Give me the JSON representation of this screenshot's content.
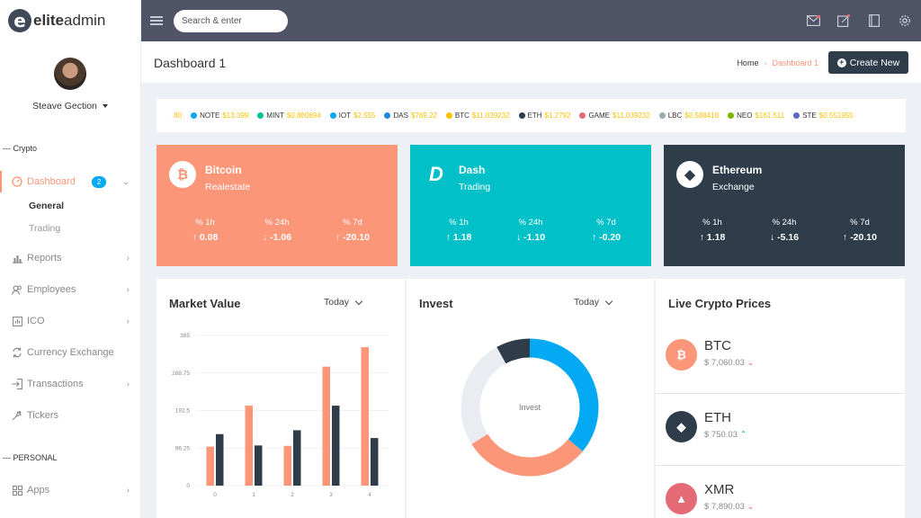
{
  "app": {
    "logo_mark": "e",
    "logo_bold": "elite",
    "logo_light": "admin"
  },
  "user": {
    "name": "Steave Gection"
  },
  "nav": {
    "caption_crypto": "--- Crypto",
    "caption_personal": "--- PERSONAL",
    "dashboard": {
      "label": "Dashboard",
      "badge": "2",
      "icon": "gauge-icon"
    },
    "sub": {
      "general": "General",
      "trading": "Trading"
    },
    "items": [
      {
        "label": "Reports",
        "icon": "bar-chart-icon",
        "has_children": true
      },
      {
        "label": "Employees",
        "icon": "users-icon",
        "has_children": true
      },
      {
        "label": "ICO",
        "icon": "ico-icon",
        "has_children": true
      },
      {
        "label": "Currency Exchange",
        "icon": "exchange-icon",
        "has_children": false
      },
      {
        "label": "Transactions",
        "icon": "sign-in-icon",
        "has_children": true
      },
      {
        "label": "Tickers",
        "icon": "tickers-icon",
        "has_children": false
      }
    ],
    "apps": {
      "label": "Apps",
      "icon": "grid-icon"
    }
  },
  "topbar": {
    "search_placeholder": "Search & enter",
    "icons": [
      "mail-icon",
      "edit-icon",
      "book-icon",
      "gear-icon"
    ]
  },
  "page": {
    "title": "Dashboard 1",
    "breadcrumb_home": "Home",
    "breadcrumb_current": "Dashboard 1",
    "create_button": "Create New"
  },
  "ticker": [
    {
      "sym": "",
      "val": ".80",
      "color": "#fec107"
    },
    {
      "sym": "NOTE",
      "val": "$13.399",
      "color": "#03a9f3"
    },
    {
      "sym": "MINT",
      "val": "$0.880694",
      "color": "#00c292"
    },
    {
      "sym": "IOT",
      "val": "$2.555",
      "color": "#03a9f3"
    },
    {
      "sym": "DAS",
      "val": "$769.22",
      "color": "#1e88e5"
    },
    {
      "sym": "BTC",
      "val": "$11.039232",
      "color": "#fec107"
    },
    {
      "sym": "ETH",
      "val": "$1.2792",
      "color": "#2f3d4a"
    },
    {
      "sym": "GAME",
      "val": "$11.039232",
      "color": "#e46a76"
    },
    {
      "sym": "LBC",
      "val": "$0.588418",
      "color": "#99abb4"
    },
    {
      "sym": "NEO",
      "val": "$161.511",
      "color": "#7ab800"
    },
    {
      "sym": "STE",
      "val": "$0.551955",
      "color": "#5c6bc0"
    }
  ],
  "coins": [
    {
      "name": "Bitcoin",
      "sub": "Realestate",
      "logo": "₿",
      "logo_icon": "bitcoin-icon",
      "bg": "#fb9678",
      "stats": [
        {
          "k": "% 1h",
          "v": "0.08",
          "dir": "↑"
        },
        {
          "k": "% 24h",
          "v": "-1.06",
          "dir": "↓"
        },
        {
          "k": "% 7d",
          "v": "-20.10",
          "dir": "↑"
        }
      ]
    },
    {
      "name": "Dash",
      "sub": "Trading",
      "logo": "D",
      "logo_icon": "dash-icon",
      "bg": "#01c0c8",
      "stats": [
        {
          "k": "% 1h",
          "v": "1.18",
          "dir": "↑"
        },
        {
          "k": "% 24h",
          "v": "-1.10",
          "dir": "↓"
        },
        {
          "k": "% 7d",
          "v": "-0.20",
          "dir": "↑"
        }
      ]
    },
    {
      "name": "Ethereum",
      "sub": "Exchange",
      "logo": "◆",
      "logo_icon": "ethereum-icon",
      "bg": "#2f3d4a",
      "stats": [
        {
          "k": "% 1h",
          "v": "1.18",
          "dir": "↑"
        },
        {
          "k": "% 24h",
          "v": "-5.16",
          "dir": "↓"
        },
        {
          "k": "% 7d",
          "v": "-20.10",
          "dir": "↑"
        }
      ]
    }
  ],
  "market": {
    "title": "Market Value",
    "period": "Today"
  },
  "invest": {
    "title": "Invest",
    "period": "Today",
    "center_label": "Invest"
  },
  "live": {
    "title": "Live Crypto Prices",
    "rows": [
      {
        "sym": "BTC",
        "price": "$ 7,060.03",
        "trend": "down",
        "bg": "#fb9678",
        "logo": "₿",
        "icon": "bitcoin-icon"
      },
      {
        "sym": "ETH",
        "price": "$ 750.03",
        "trend": "up",
        "bg": "#2f3d4a",
        "logo": "◆",
        "icon": "ethereum-icon"
      },
      {
        "sym": "XMR",
        "price": "$ 7,890.03",
        "trend": "down",
        "bg": "#e46a76",
        "logo": "▲",
        "icon": "monero-icon"
      }
    ]
  },
  "chart_data": [
    {
      "type": "bar",
      "categories": [
        "0",
        "1",
        "2",
        "3",
        "4"
      ],
      "series": [
        {
          "values": [
            100,
            205,
            102,
            305,
            355
          ],
          "color": "#fb9678"
        },
        {
          "values": [
            132,
            103,
            142,
            205,
            122
          ],
          "color": "#2f3d4a"
        }
      ],
      "yticks": [
        "0",
        "96.25",
        "192.5",
        "288.75",
        "385"
      ],
      "ylim": [
        0,
        385
      ],
      "grid": true
    },
    {
      "type": "pie",
      "donut": true,
      "slices": [
        {
          "value": 36,
          "color": "#03a9f3"
        },
        {
          "value": 30,
          "color": "#fb9678"
        },
        {
          "value": 26,
          "color": "#e9edf2"
        },
        {
          "value": 8,
          "color": "#2f3d4a"
        }
      ]
    }
  ]
}
